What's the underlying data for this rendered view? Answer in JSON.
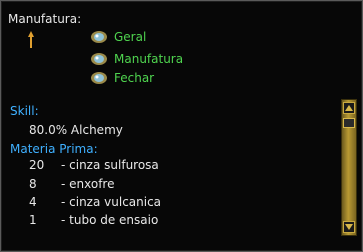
{
  "window": {
    "title": "Manufatura:"
  },
  "menu": {
    "items": [
      {
        "label": "Geral"
      },
      {
        "label": "Manufatura"
      },
      {
        "label": "Fechar"
      }
    ]
  },
  "skill": {
    "header": "Skill:",
    "value": "80.0% Alchemy"
  },
  "materials": {
    "header": "Materia Prima:",
    "rows": [
      {
        "qty": "20",
        "name": "- cinza sulfurosa"
      },
      {
        "qty": "8",
        "name": "- enxofre"
      },
      {
        "qty": "4",
        "name": "- cinza vulcanica"
      },
      {
        "qty": "1",
        "name": "- tubo de ensaio"
      }
    ]
  },
  "colors": {
    "menu_text": "#4fd44f",
    "section_header": "#3fb0ff",
    "body_text": "#e8e8e8",
    "scrollbar_gold": "#b99a33"
  }
}
